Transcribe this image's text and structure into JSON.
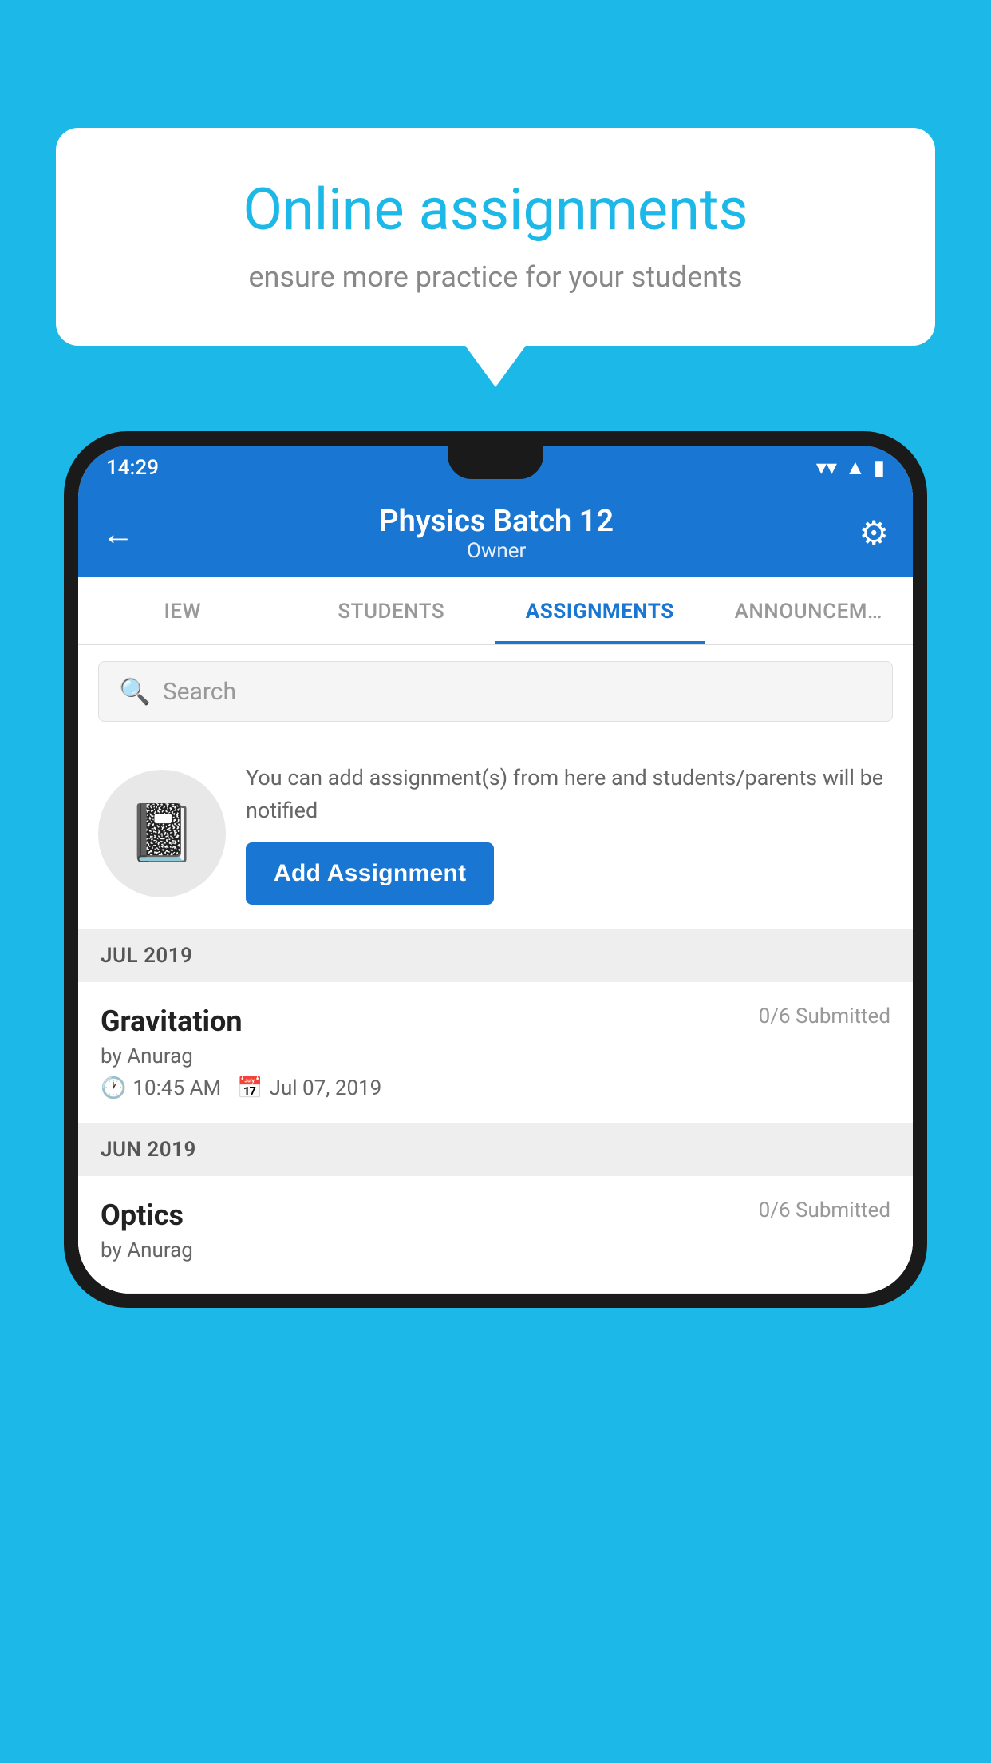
{
  "background": {
    "color": "#1BB8E8"
  },
  "speech_bubble": {
    "title": "Online assignments",
    "subtitle": "ensure more practice for your students"
  },
  "status_bar": {
    "time": "14:29",
    "wifi_icon": "wifi",
    "signal_icon": "signal",
    "battery_icon": "battery"
  },
  "app_bar": {
    "title": "Physics Batch 12",
    "subtitle": "Owner",
    "back_icon": "back-arrow",
    "settings_icon": "settings-gear"
  },
  "tabs": [
    {
      "label": "IEW",
      "active": false
    },
    {
      "label": "STUDENTS",
      "active": false
    },
    {
      "label": "ASSIGNMENTS",
      "active": true
    },
    {
      "label": "ANNOUNCEM…",
      "active": false
    }
  ],
  "search": {
    "placeholder": "Search"
  },
  "promo": {
    "description": "You can add assignment(s) from here and students/parents will be notified",
    "button_label": "Add Assignment"
  },
  "sections": [
    {
      "month_label": "JUL 2019",
      "assignments": [
        {
          "name": "Gravitation",
          "submitted": "0/6 Submitted",
          "by": "by Anurag",
          "time": "10:45 AM",
          "date": "Jul 07, 2019"
        }
      ]
    },
    {
      "month_label": "JUN 2019",
      "assignments": [
        {
          "name": "Optics",
          "submitted": "0/6 Submitted",
          "by": "by Anurag",
          "time": "",
          "date": ""
        }
      ]
    }
  ]
}
